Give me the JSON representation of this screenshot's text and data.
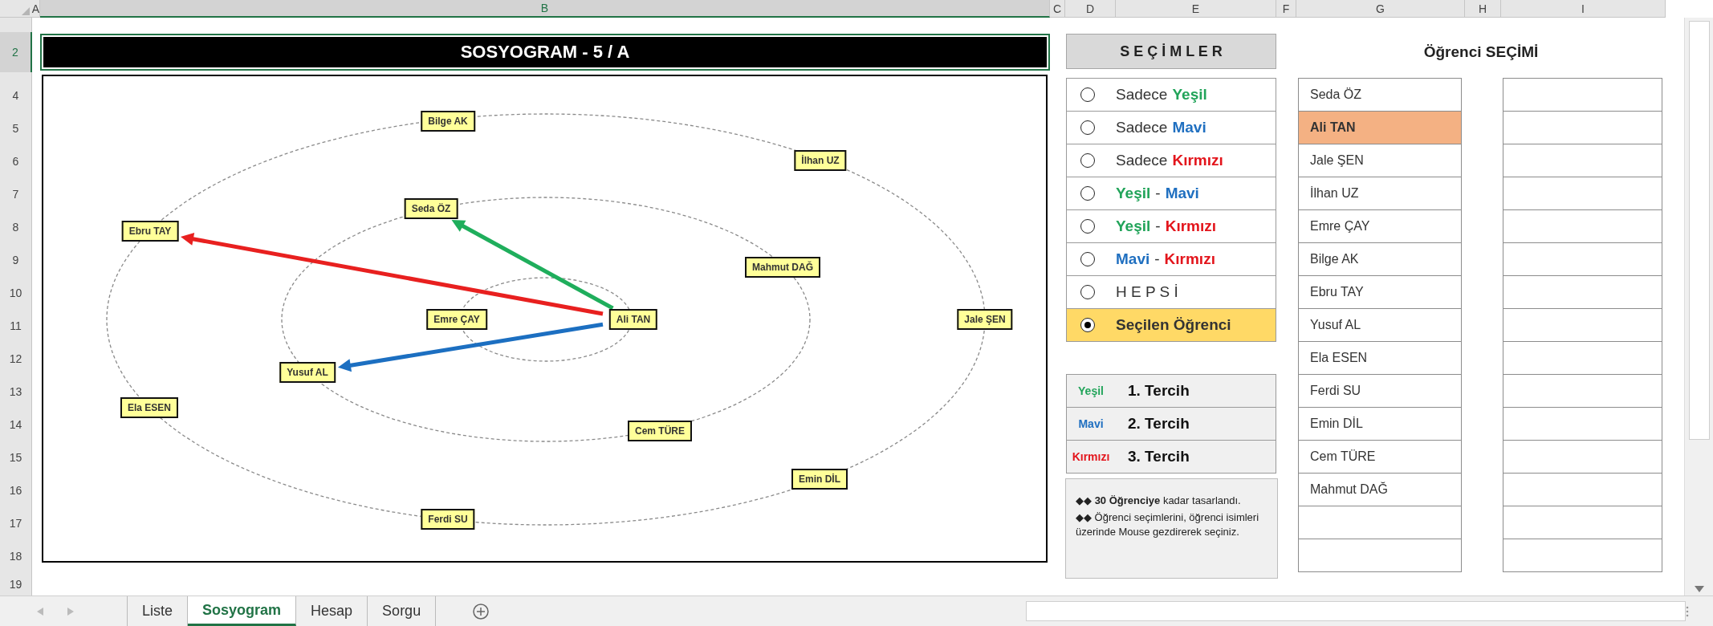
{
  "column_headers": [
    {
      "label": "A",
      "selected": false
    },
    {
      "label": "B",
      "selected": true
    },
    {
      "label": "C",
      "selected": false
    },
    {
      "label": "D",
      "selected": false
    },
    {
      "label": "E",
      "selected": false
    },
    {
      "label": "F",
      "selected": false
    },
    {
      "label": "G",
      "selected": false
    },
    {
      "label": "H",
      "selected": false
    },
    {
      "label": "I",
      "selected": false
    }
  ],
  "row_headers": [
    {
      "label": "2",
      "selected": true
    },
    {
      "label": "4",
      "selected": false
    },
    {
      "label": "5",
      "selected": false
    },
    {
      "label": "6",
      "selected": false
    },
    {
      "label": "7",
      "selected": false
    },
    {
      "label": "8",
      "selected": false
    },
    {
      "label": "9",
      "selected": false
    },
    {
      "label": "10",
      "selected": false
    },
    {
      "label": "11",
      "selected": false
    },
    {
      "label": "12",
      "selected": false
    },
    {
      "label": "13",
      "selected": false
    },
    {
      "label": "14",
      "selected": false
    },
    {
      "label": "15",
      "selected": false
    },
    {
      "label": "16",
      "selected": false
    },
    {
      "label": "17",
      "selected": false
    },
    {
      "label": "18",
      "selected": false
    },
    {
      "label": "19",
      "selected": false
    }
  ],
  "title": "SOSYOGRAM - 5 / A",
  "sociogram": {
    "nodes": [
      {
        "name": "Bilge AK"
      },
      {
        "name": "İlhan UZ"
      },
      {
        "name": "Seda ÖZ"
      },
      {
        "name": "Ebru TAY"
      },
      {
        "name": "Mahmut DAĞ"
      },
      {
        "name": "Emre ÇAY"
      },
      {
        "name": "Ali TAN"
      },
      {
        "name": "Jale ŞEN"
      },
      {
        "name": "Yusuf AL"
      },
      {
        "name": "Ela ESEN"
      },
      {
        "name": "Cem TÜRE"
      },
      {
        "name": "Emin DİL"
      },
      {
        "name": "Ferdi SU"
      }
    ],
    "arrows": [
      {
        "color": "#1fae5c"
      },
      {
        "color": "#e8201f"
      },
      {
        "color": "#1c6fc1"
      }
    ]
  },
  "choices": {
    "header": "S E Ç İ M L E R",
    "options": [
      {
        "selected": false,
        "parts": [
          {
            "text": "Sadece"
          },
          {
            "text": "Yeşil",
            "color": "#22a45a"
          }
        ]
      },
      {
        "selected": false,
        "parts": [
          {
            "text": "Sadece"
          },
          {
            "text": "Mavi",
            "color": "#1f6fc0"
          }
        ]
      },
      {
        "selected": false,
        "parts": [
          {
            "text": "Sadece"
          },
          {
            "text": "Kırmızı",
            "color": "#e3151c"
          }
        ]
      },
      {
        "selected": false,
        "parts": [
          {
            "text": "Yeşil",
            "color": "#22a45a"
          },
          {
            "text": "-"
          },
          {
            "text": "Mavi",
            "color": "#1f6fc0"
          }
        ]
      },
      {
        "selected": false,
        "parts": [
          {
            "text": "Yeşil",
            "color": "#22a45a"
          },
          {
            "text": "-"
          },
          {
            "text": "Kırmızı",
            "color": "#e3151c"
          }
        ]
      },
      {
        "selected": false,
        "parts": [
          {
            "text": "Mavi",
            "color": "#1f6fc0"
          },
          {
            "text": "-"
          },
          {
            "text": "Kırmızı",
            "color": "#e3151c"
          }
        ]
      },
      {
        "selected": false,
        "parts": [
          {
            "text": "H E P S İ"
          }
        ]
      },
      {
        "selected": true,
        "parts": [
          {
            "text": "Seçilen Öğrenci"
          }
        ]
      }
    ]
  },
  "legend": [
    {
      "label": "Yeşil",
      "color": "#22a45a",
      "text": "1. Tercih"
    },
    {
      "label": "Mavi",
      "color": "#1f6fc0",
      "text": "2. Tercih"
    },
    {
      "label": "Kırmızı",
      "color": "#e3151c",
      "text": "3. Tercih"
    }
  ],
  "notes": [
    "◆◆ **30 Öğrenciye** kadar tasarlandı.",
    "◆◆ Öğrenci seçimlerini, öğrenci isimleri üzerinde Mouse gezdirerek seçiniz."
  ],
  "student_selection": {
    "title": "Öğrenci SEÇİMİ",
    "students": [
      {
        "name": "Seda ÖZ",
        "selected": false
      },
      {
        "name": "Ali TAN",
        "selected": true
      },
      {
        "name": "Jale ŞEN",
        "selected": false
      },
      {
        "name": "İlhan UZ",
        "selected": false
      },
      {
        "name": "Emre ÇAY",
        "selected": false
      },
      {
        "name": "Bilge AK",
        "selected": false
      },
      {
        "name": "Ebru TAY",
        "selected": false
      },
      {
        "name": "Yusuf AL",
        "selected": false
      },
      {
        "name": "Ela ESEN",
        "selected": false
      },
      {
        "name": "Ferdi SU",
        "selected": false
      },
      {
        "name": "Emin DİL",
        "selected": false
      },
      {
        "name": "Cem TÜRE",
        "selected": false
      },
      {
        "name": "Mahmut DAĞ",
        "selected": false
      }
    ]
  },
  "sheet_tabs": [
    {
      "label": "Liste",
      "selected": false
    },
    {
      "label": "Sosyogram",
      "selected": true
    },
    {
      "label": "Hesap",
      "selected": false
    },
    {
      "label": "Sorgu",
      "selected": false
    }
  ]
}
